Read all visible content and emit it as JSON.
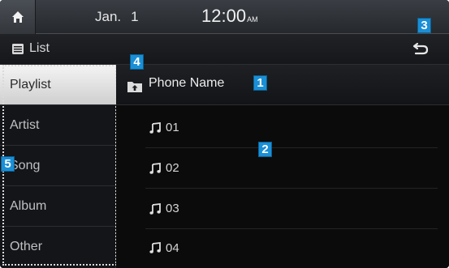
{
  "status_bar": {
    "month": "Jan.",
    "day": "1",
    "time": "12:00",
    "ampm": "AM"
  },
  "header": {
    "title": "List"
  },
  "sidebar": {
    "categories": [
      {
        "label": "Playlist",
        "active": true
      },
      {
        "label": "Artist",
        "active": false
      },
      {
        "label": "Song",
        "active": false
      },
      {
        "label": "Album",
        "active": false
      },
      {
        "label": "Other",
        "active": false
      }
    ]
  },
  "content": {
    "folder_name": "Phone Name",
    "songs": [
      "01",
      "02",
      "03",
      "04"
    ]
  },
  "markers": [
    "1",
    "2",
    "3",
    "4",
    "5"
  ],
  "icons": {
    "home": "home-icon",
    "list": "list-icon",
    "back": "back-arrow-icon",
    "folder": "folder-up-icon",
    "note": "music-note-icon"
  },
  "colors": {
    "marker": "#1a8fd6",
    "active_tab": "#e6e6e6",
    "background": "#0b0b0b"
  }
}
